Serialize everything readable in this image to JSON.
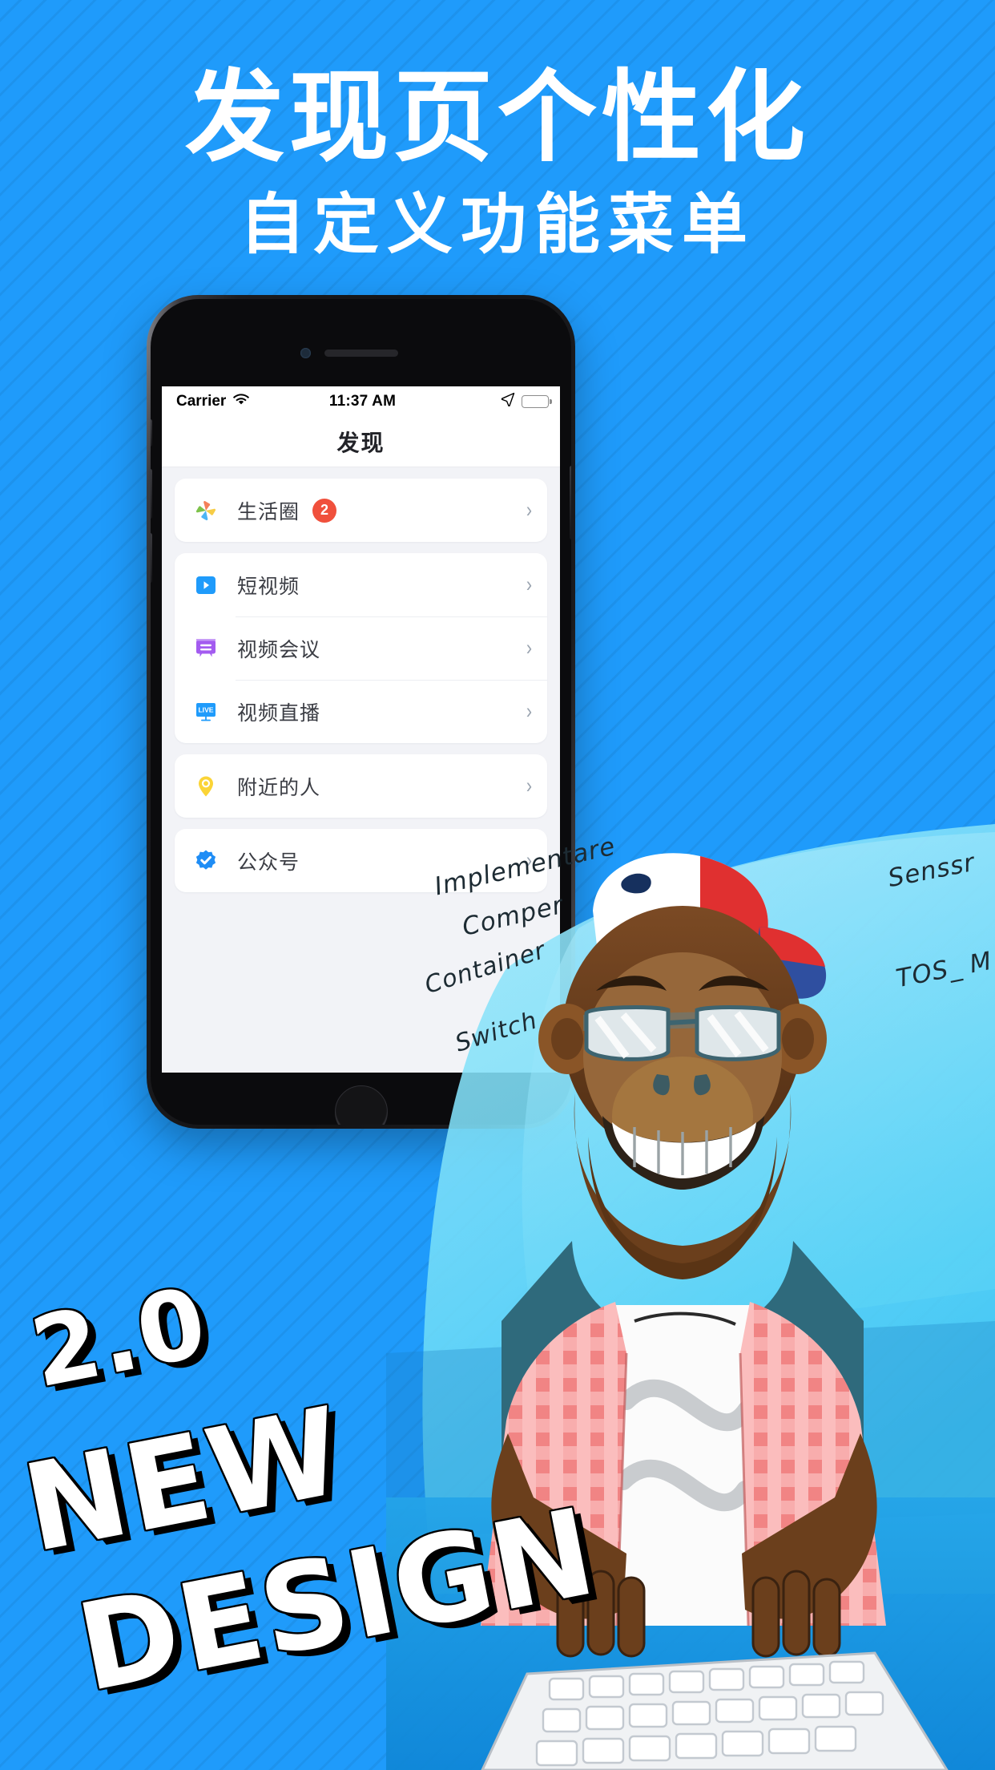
{
  "poster": {
    "background_color": "#1f9bfb",
    "headline": "发现页个性化",
    "subheadline": "自定义功能菜单",
    "display_type": {
      "version": "2.0",
      "line1": "NEW",
      "line2": "DESIGN"
    }
  },
  "phone": {
    "status_bar": {
      "carrier": "Carrier",
      "wifi_icon": "wifi-icon",
      "time": "11:37 AM",
      "location_icon": "location-arrow-icon",
      "battery_icon": "battery-full-icon"
    },
    "nav_bar": {
      "title": "发现"
    },
    "groups": [
      {
        "rows": [
          {
            "label": "生活圈",
            "icon": "lifecircle-pinwheel-icon",
            "badge": "2",
            "badge_color": "#f0503c",
            "chevron": "›"
          }
        ]
      },
      {
        "rows": [
          {
            "label": "短视频",
            "icon": "short-video-play-icon",
            "badge": "",
            "chevron": "›"
          },
          {
            "label": "视频会议",
            "icon": "video-meeting-icon",
            "badge": "",
            "chevron": "›"
          },
          {
            "label": "视频直播",
            "icon": "live-stream-icon",
            "badge": "",
            "chevron": "›"
          }
        ]
      },
      {
        "rows": [
          {
            "label": "附近的人",
            "icon": "nearby-people-pin-icon",
            "badge": "",
            "chevron": "›"
          }
        ]
      },
      {
        "rows": [
          {
            "label": "公众号",
            "icon": "official-account-verified-icon",
            "badge": "",
            "chevron": "›"
          }
        ]
      }
    ]
  },
  "illustration": {
    "character": "gorilla-developer-illustration",
    "notes": [
      "Implementare",
      "Comper",
      "Container",
      "Switch",
      "Senssr",
      "TOS_ M"
    ]
  }
}
